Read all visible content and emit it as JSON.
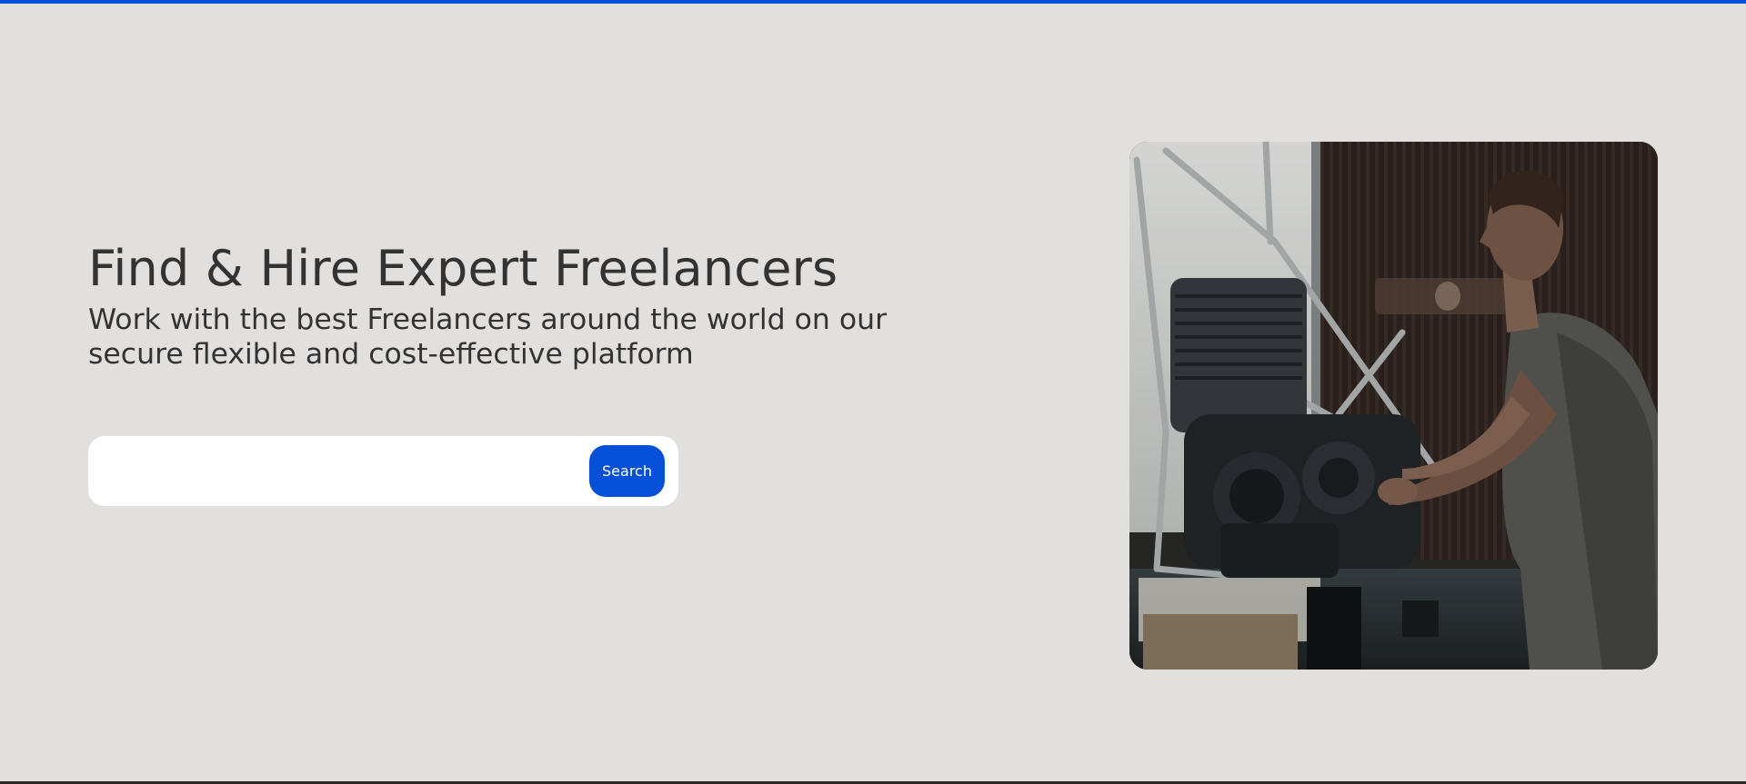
{
  "hero": {
    "title": "Find & Hire Expert Freelancers",
    "subtitle": "Work with the best Freelancers around the world on our secure flexible and cost-effective platform"
  },
  "search": {
    "placeholder": "",
    "value": "",
    "button_label": "Search"
  },
  "image": {
    "subject": "man-repairing-motorcycle-engine-photo"
  },
  "colors": {
    "accent": "#0650d8",
    "background": "#e1e0df",
    "text": "#333333",
    "search_bg": "#ffffff"
  }
}
